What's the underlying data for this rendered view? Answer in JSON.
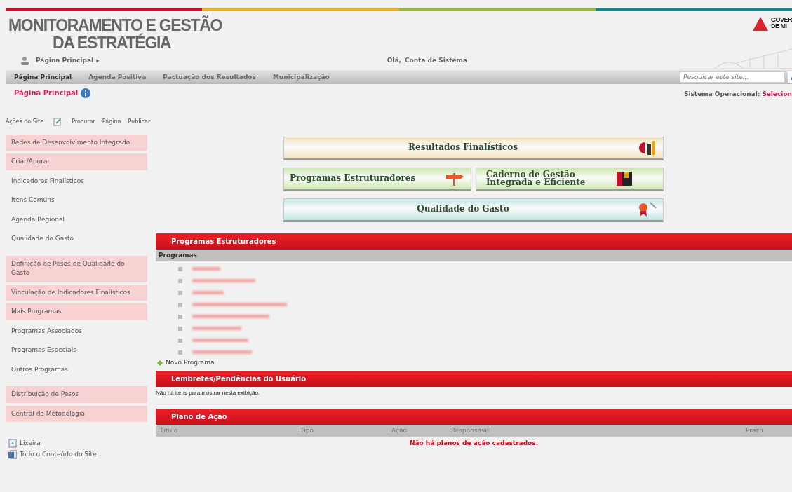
{
  "header": {
    "title_line_1": "MONITORAMENTO E GESTÃO",
    "title_line_2": "DA ESTRATÉGIA",
    "logo_lines": [
      "GOVER",
      "DE MI"
    ],
    "breadcrumb": "Página Principal",
    "breadcrumb_arrow": "▸",
    "greeting": "Olá,",
    "user": "Conta de Sistema"
  },
  "top_nav": [
    {
      "label": "Página Principal",
      "selected": true
    },
    {
      "label": "Agenda Positiva",
      "selected": false
    },
    {
      "label": "Pactuação dos Resultados",
      "selected": false
    },
    {
      "label": "Municipalização",
      "selected": false
    }
  ],
  "search": {
    "placeholder": "Pesquisar este site..."
  },
  "page_title": "Página Principal",
  "system": {
    "label": "Sistema Operacional:",
    "value": "Selecion"
  },
  "site_actions": [
    "Ações do Site",
    "Procurar",
    "Página",
    "Publicar"
  ],
  "sidebar": {
    "groups": [
      [
        {
          "label": "Redes de Desenvolvimento Integrado",
          "highlighted": true
        },
        {
          "label": "Criar/Apurar",
          "highlighted": true
        },
        {
          "label": "Indicadores Finalísticos",
          "highlighted": false
        },
        {
          "label": "Itens Comuns",
          "highlighted": false
        },
        {
          "label": "Agenda Regional",
          "highlighted": false
        },
        {
          "label": "Qualidade do Gasto",
          "highlighted": false
        }
      ],
      [
        {
          "label": "Definição de Pesos de Qualidade do Gasto",
          "highlighted": true
        },
        {
          "label": "Vinculação de Indicadores Finalísticos",
          "highlighted": true
        },
        {
          "label": "Mais Programas",
          "highlighted": true
        },
        {
          "label": "Programas Associados",
          "highlighted": false
        },
        {
          "label": "Programas Especiais",
          "highlighted": false
        },
        {
          "label": "Outros Programas",
          "highlighted": false
        }
      ],
      [
        {
          "label": "Distribuição de Pesos",
          "highlighted": true
        },
        {
          "label": "Central de Metodologia",
          "highlighted": true
        }
      ]
    ],
    "footer_links": [
      {
        "label": "Lixeira",
        "kind": "trash"
      },
      {
        "label": "Todo o Conteúdo do Site",
        "kind": "content"
      }
    ]
  },
  "tiles": [
    {
      "label": "Resultados Finalísticos",
      "color": "#f3e3bf",
      "kind": "chart",
      "wide": true
    },
    {
      "label": "Programas Estruturadores",
      "color": "#cde8b0",
      "kind": "signpost",
      "wide": false
    },
    {
      "label": "Caderno de Gestão Integrada e Eficiente",
      "color": "#cde8b0",
      "kind": "book",
      "wide": false
    },
    {
      "label": "Qualidade do Gasto",
      "color": "#c3e6e6",
      "kind": "award",
      "wide": true
    }
  ],
  "programs_panel": {
    "title": "Programas Estruturadores",
    "column": "Programas",
    "items": [
      {
        "kind": "redacted"
      },
      {
        "kind": "redacted"
      },
      {
        "kind": "redacted"
      },
      {
        "kind": "redacted"
      },
      {
        "kind": "redacted"
      },
      {
        "kind": "redacted"
      },
      {
        "kind": "redacted"
      },
      {
        "kind": "redacted"
      }
    ],
    "new_link": "Novo Programa"
  },
  "reminders_panel": {
    "title": "Lembretes/Pendências do Usuário",
    "empty": "Não há itens para mostrar nesta exibição."
  },
  "plan_panel": {
    "title": "Plano de Ação",
    "columns": [
      "Título",
      "Tipo",
      "Ação",
      "Responsável",
      "Prazo"
    ],
    "empty": "Não há planos de ação cadastrados."
  }
}
